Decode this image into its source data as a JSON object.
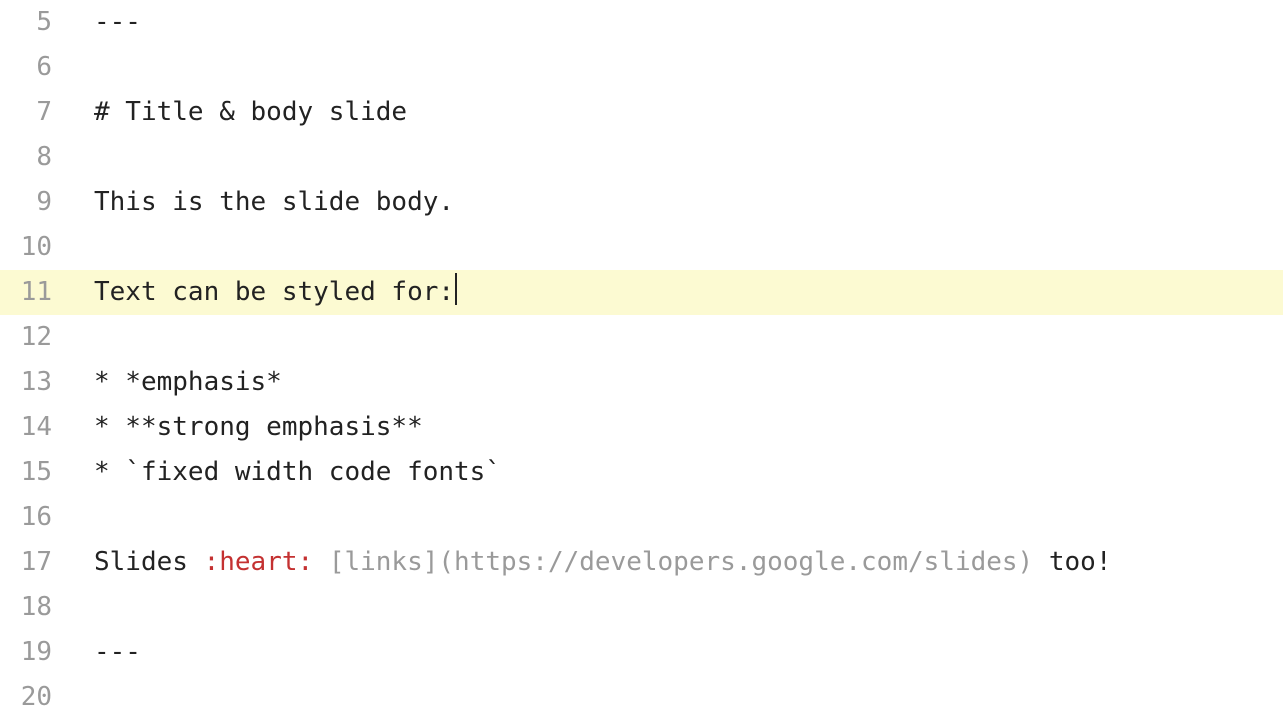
{
  "editor": {
    "active_line_index": 6,
    "lines": [
      {
        "num": "5",
        "spans": [
          {
            "cls": "t-default",
            "text": "---"
          }
        ]
      },
      {
        "num": "6",
        "spans": []
      },
      {
        "num": "7",
        "spans": [
          {
            "cls": "t-default",
            "text": "# Title & body slide"
          }
        ]
      },
      {
        "num": "8",
        "spans": []
      },
      {
        "num": "9",
        "spans": [
          {
            "cls": "t-default",
            "text": "This is the slide body."
          }
        ]
      },
      {
        "num": "10",
        "spans": []
      },
      {
        "num": "11",
        "spans": [
          {
            "cls": "t-default",
            "text": "Text can be styled for:"
          }
        ],
        "cursor_after": true
      },
      {
        "num": "12",
        "spans": []
      },
      {
        "num": "13",
        "spans": [
          {
            "cls": "t-default",
            "text": "* *emphasis*"
          }
        ]
      },
      {
        "num": "14",
        "spans": [
          {
            "cls": "t-default",
            "text": "* **strong emphasis**"
          }
        ]
      },
      {
        "num": "15",
        "spans": [
          {
            "cls": "t-default",
            "text": "* `fixed width code fonts`"
          }
        ]
      },
      {
        "num": "16",
        "spans": []
      },
      {
        "num": "17",
        "spans": [
          {
            "cls": "t-default",
            "text": "Slides "
          },
          {
            "cls": "t-emoji",
            "text": ":heart:"
          },
          {
            "cls": "t-default",
            "text": " "
          },
          {
            "cls": "t-link",
            "text": "[links](https://developers.google.com/slides)"
          },
          {
            "cls": "t-default",
            "text": " too!"
          }
        ]
      },
      {
        "num": "18",
        "spans": []
      },
      {
        "num": "19",
        "spans": [
          {
            "cls": "t-default",
            "text": "---"
          }
        ]
      },
      {
        "num": "20",
        "spans": []
      }
    ]
  }
}
